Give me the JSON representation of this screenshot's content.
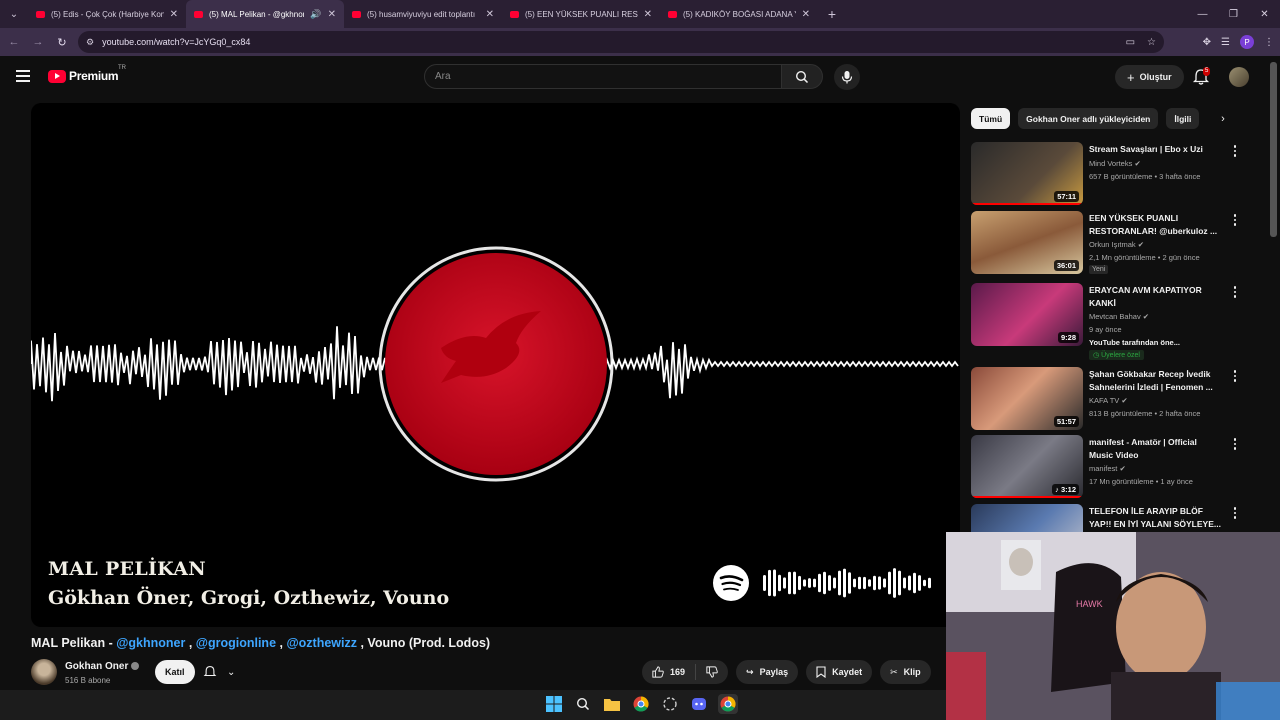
{
  "browser": {
    "tabs": [
      {
        "title": "(5) Edis - Çok Çok (Harbiye Kon",
        "active": false,
        "audio": false
      },
      {
        "title": "(5) MAL Pelikan - @gkhnon",
        "active": true,
        "audio": true
      },
      {
        "title": "(5) husamviyuviyu edit toplantı",
        "active": false,
        "audio": false
      },
      {
        "title": "(5) EEN YÜKSEK PUANLI RESTO",
        "active": false,
        "audio": false
      },
      {
        "title": "(5) KADIKÖY BOĞASI ADANA Y",
        "active": false,
        "audio": false
      }
    ],
    "url": "youtube.com/watch?v=JcYGq0_cx84",
    "profile_initial": "P"
  },
  "header": {
    "logo_text": "Premium",
    "country_code": "TR",
    "search_placeholder": "Ara",
    "create_label": "Oluştur",
    "notification_count": "5"
  },
  "player": {
    "track_title": "MAL PELİKAN",
    "track_artists": "Gökhan Öner, Grogi, Ozthewiz, Vouno",
    "accent_color": "#d0021b"
  },
  "video": {
    "title_prefix": "MAL Pelikan - ",
    "title_link1": "@gkhnoner",
    "title_sep1": " , ",
    "title_link2": "@grogionline",
    "title_sep2": " , ",
    "title_link3": "@ozthewizz",
    "title_suffix": " , Vouno (Prod. Lodos)",
    "channel_name": "Gokhan Oner",
    "subscribers": "516 B abone",
    "join_label": "Katıl",
    "like_count": "169",
    "share_label": "Paylaş",
    "save_label": "Kaydet",
    "clip_label": "Klip"
  },
  "sidebar": {
    "chips": [
      "Tümü",
      "Gokhan Oner adlı yükleyiciden",
      "İlgili"
    ],
    "videos": [
      {
        "title": "Stream Savaşları | Ebo x Uzi",
        "channel": "Mind Vorteks",
        "meta": "657 B görüntüleme • 3 hafta önce",
        "duration": "57:11",
        "thumb_color": "#5a4a3a"
      },
      {
        "title": "EEN YÜKSEK PUANLI RESTORANLAR! @uberkuloz ...",
        "channel": "Orkun Işıtmak",
        "meta": "2,1 Mn görüntüleme • 2 gün önce",
        "badge": "Yeni",
        "duration": "36:01",
        "thumb_color": "#8a5a3a"
      },
      {
        "title": "ERAYCAN AVM KAPATIYOR KANKİ",
        "channel": "Mevtcan Bahav",
        "meta": "9 ay önce",
        "extra": "YouTube tarafından öne...",
        "members": "Üyelere özel",
        "duration": "9:28",
        "thumb_color": "#7a2a5a"
      },
      {
        "title": "Şahan Gökbakar Recep İvedik Sahnelerini İzledi | Fenomen ...",
        "channel": "KAFA TV",
        "meta": "813 B görüntüleme • 2 hafta önce",
        "duration": "51:57",
        "thumb_color": "#6a3a3a"
      },
      {
        "title": "manifest - Amatör | Official Music Video",
        "channel": "manifest",
        "meta": "17 Mn görüntüleme • 1 ay önce",
        "duration": "3:12",
        "thumb_color": "#4a4a55"
      },
      {
        "title": "TELEFON İLE ARAYIP BLÖF YAP!! EN İYİ YALANI SÖYLEYE...",
        "channel": "",
        "meta": "",
        "duration": "",
        "thumb_color": "#3a4a6a"
      }
    ]
  }
}
